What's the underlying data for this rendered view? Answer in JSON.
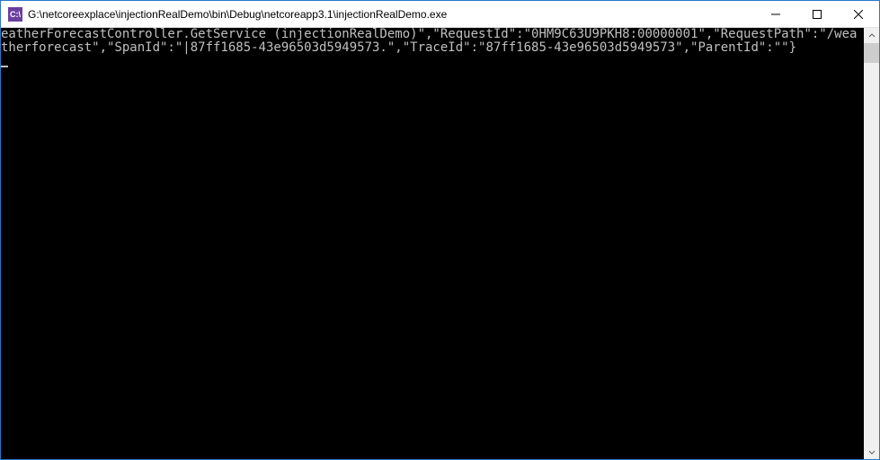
{
  "titlebar": {
    "icon_text": "C:\\",
    "title": "G:\\netcoreexplace\\injectionRealDemo\\bin\\Debug\\netcoreapp3.1\\injectionRealDemo.exe"
  },
  "console": {
    "line1": "eatherForecastController.GetService (injectionRealDemo)\",\"RequestId\":\"0HM9C63U9PKH8:00000001\",\"RequestPath\":\"/weatherforecast\",\"SpanId\":\"|87ff1685-43e96503d5949573.\",\"TraceId\":\"87ff1685-43e96503d5949573\",\"ParentId\":\"\"}"
  }
}
